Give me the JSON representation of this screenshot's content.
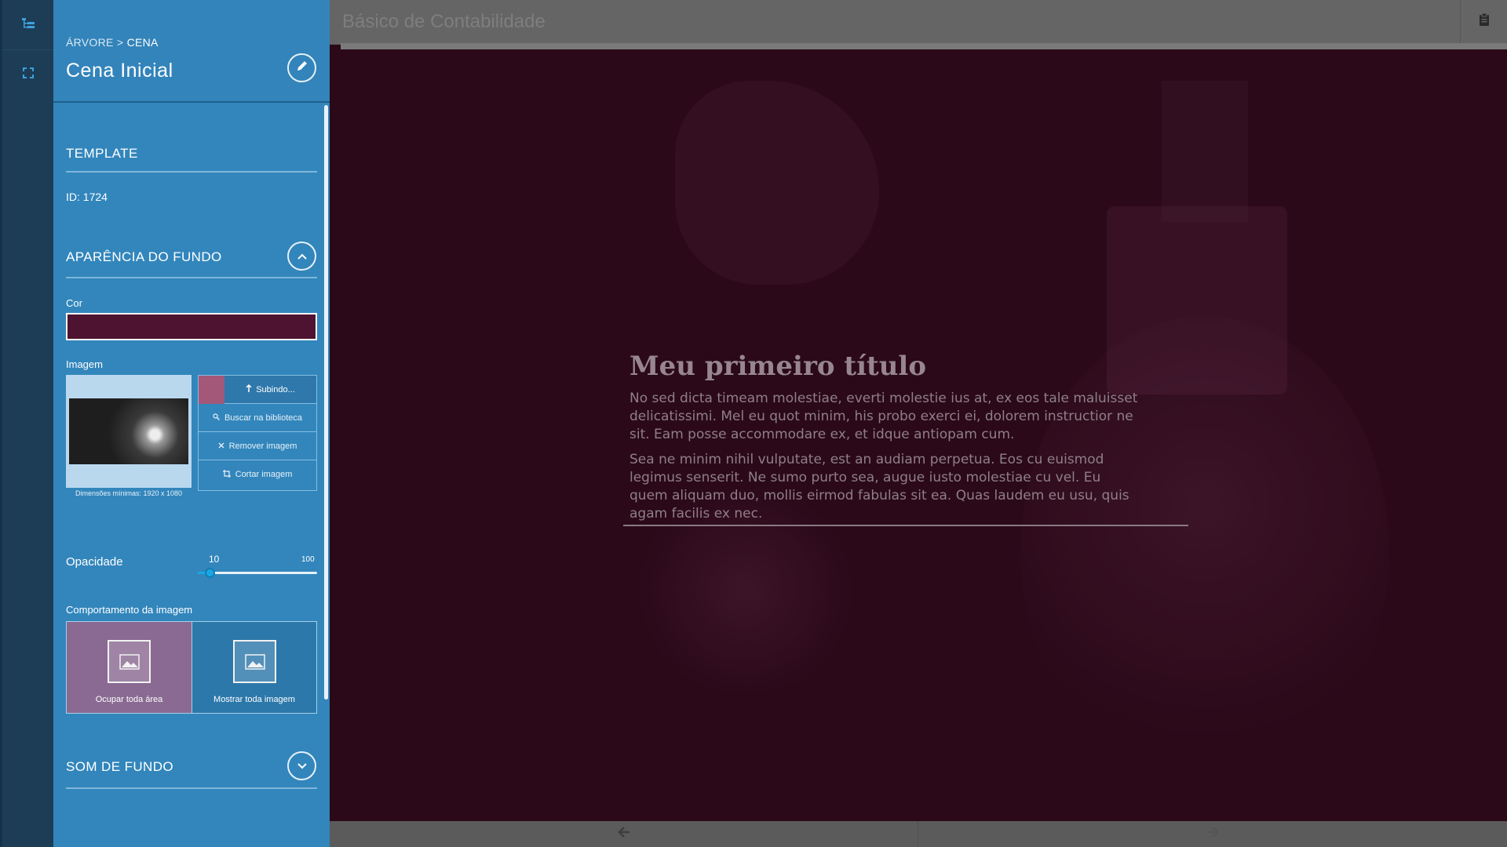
{
  "rail": {
    "icons": [
      "tree-icon",
      "fullscreen-icon"
    ]
  },
  "sidebar": {
    "breadcrumb": {
      "root": "ÁRVORE",
      "separator": ">",
      "current": "CENA"
    },
    "title": "Cena Inicial",
    "template_section": {
      "title": "TEMPLATE",
      "id_text": "ID: 1724"
    },
    "background_section": {
      "title": "APARÊNCIA DO FUNDO",
      "color_label": "Cor",
      "color_value": "#4d1330",
      "image_label": "Imagem",
      "image_dimensions": "Dimensões mínimas: 1920 x 1080",
      "actions": {
        "upload": "Subindo...",
        "search": "Buscar na biblioteca",
        "remove": "Remover imagem",
        "crop": "Cortar imagem"
      },
      "opacity": {
        "label": "Opacidade",
        "value": "10",
        "max": "100",
        "fraction": 0.1
      },
      "behavior": {
        "label": "Comportamento da imagem",
        "options": [
          "Ocupar toda área",
          "Mostrar toda imagem"
        ],
        "selected": "Ocupar toda área"
      }
    },
    "sound_section": {
      "title": "SOM DE FUNDO"
    }
  },
  "editor": {
    "doc_title": "Básico de Contabilidade",
    "content": {
      "title": "Meu primeiro título",
      "paragraph1": "No sed dicta timeam molestiae, everti molestie ius at, ex eos tale maluisset delicatissimi. Mel eu quot minim, his probo exerci ei, dolorem instructior ne sit. Eam posse accommodare ex, et idque antiopam cum.",
      "paragraph2": "Sea ne minim nihil vulputate, est an audiam perpetua. Eos cu euismod legimus senserit. Ne sumo purto sea, augue iusto molestiae cu vel. Eu quem aliquam duo, mollis eirmod fabulas sit ea. Quas laudem eu usu, quis agam facilis ex nec."
    }
  },
  "colors": {
    "sidebar": "#3286bc",
    "rail": "#1d3d57",
    "canvas": "#2b0919",
    "accent": "#1aa6e6"
  }
}
